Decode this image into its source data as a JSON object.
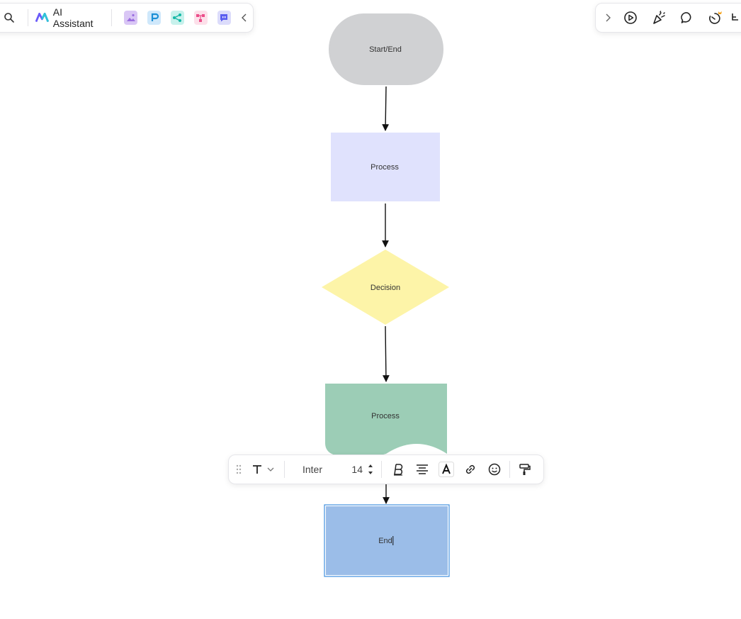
{
  "toolbar_left": {
    "ai_assistant_label": "AI Assistant",
    "apps": [
      {
        "icon": "image-generator-icon",
        "color": "#d9c6f5"
      },
      {
        "icon": "presentation-icon",
        "color": "#cfe8fb"
      },
      {
        "icon": "mindmap-icon",
        "color": "#c7f1ec"
      },
      {
        "icon": "flowchart-icon",
        "color": "#fde0ea"
      },
      {
        "icon": "chat-icon",
        "color": "#dcdcfb"
      }
    ]
  },
  "diagram": {
    "nodes": [
      {
        "label": "Start/End",
        "shape": "terminator",
        "color": "#d0d1d3"
      },
      {
        "label": "Process",
        "shape": "rectangle",
        "color": "#e0e2fd"
      },
      {
        "label": "Decision",
        "shape": "diamond",
        "color": "#fdf4a8"
      },
      {
        "label": "Process",
        "shape": "document",
        "color": "#9ccdb6"
      },
      {
        "label": "End",
        "shape": "rectangle",
        "color": "#9bbde8"
      }
    ],
    "selection_color": "#3f8fde"
  },
  "format_toolbar": {
    "font_name": "Inter",
    "font_size": "14"
  }
}
